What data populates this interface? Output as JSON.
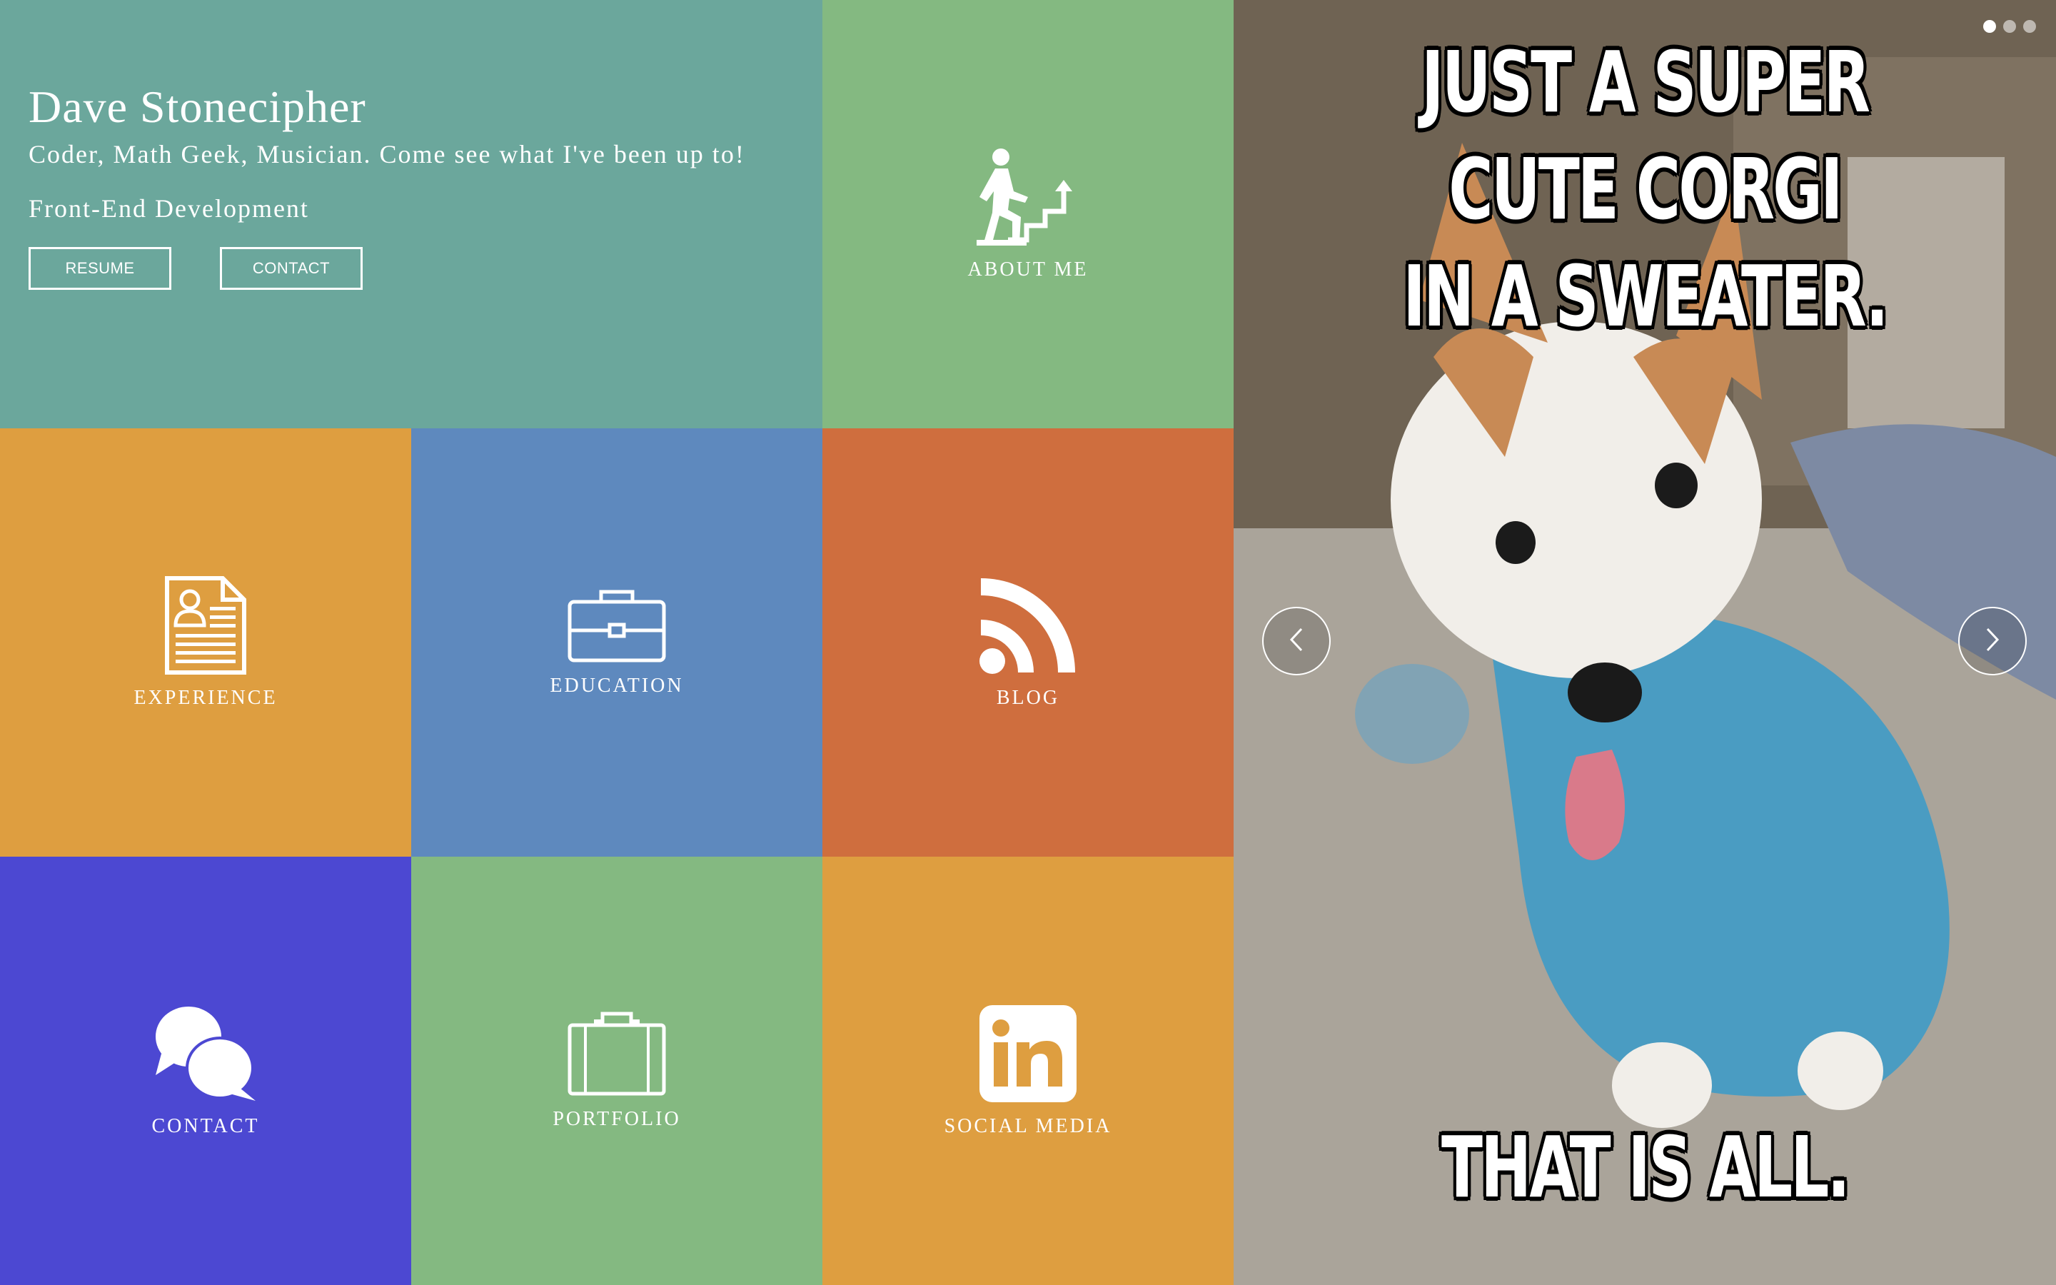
{
  "hero": {
    "name": "Dave Stonecipher",
    "tagline": "Coder, Math Geek, Musician. Come see what I've been up to!",
    "subtitle": "Front-End Development",
    "resume_button": "RESUME",
    "contact_button": "CONTACT",
    "bg_color": "#6ba79c"
  },
  "tiles": {
    "about": {
      "label": "ABOUT ME",
      "icon": "stairs-climb-icon",
      "color": "#84b981"
    },
    "experience": {
      "label": "EXPERIENCE",
      "icon": "resume-document-icon",
      "color": "#de9e40"
    },
    "education": {
      "label": "EDUCATION",
      "icon": "briefcase-icon",
      "color": "#5e89be"
    },
    "blog": {
      "label": "BLOG",
      "icon": "rss-icon",
      "color": "#cf6e3e"
    },
    "contact": {
      "label": "CONTACT",
      "icon": "chat-bubbles-icon",
      "color": "#4c48d2"
    },
    "portfolio": {
      "label": "PORTFOLIO",
      "icon": "portfolio-case-icon",
      "color": "#84b981"
    },
    "social": {
      "label": "SOCIAL MEDIA",
      "icon": "linkedin-icon",
      "color": "#de9e40"
    }
  },
  "carousel": {
    "caption_top_line1": "JUST A SUPER CUTE CORGI",
    "caption_top_line2": "IN A SWEATER.",
    "caption_bottom": "THAT IS ALL.",
    "slide_count": 3,
    "active_slide": 1,
    "sweater_color": "#4a9cc2"
  }
}
